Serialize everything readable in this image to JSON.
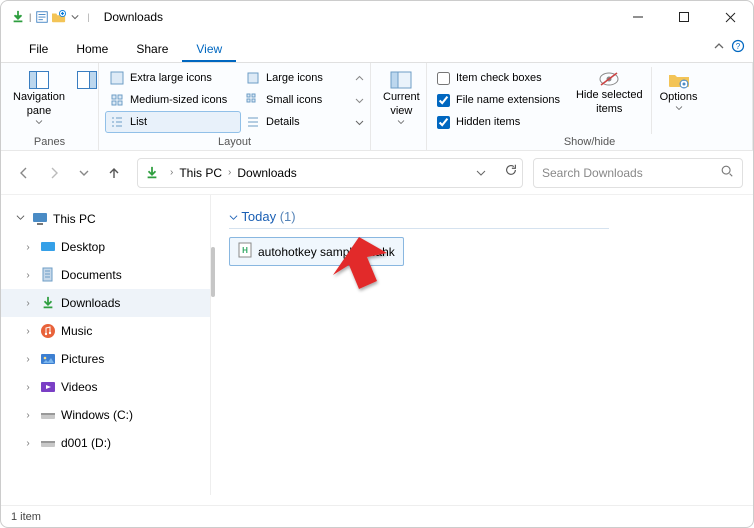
{
  "window": {
    "title": "Downloads"
  },
  "menus": {
    "file": "File",
    "home": "Home",
    "share": "Share",
    "view": "View"
  },
  "ribbon": {
    "panes_group": "Panes",
    "nav_pane": "Navigation\npane",
    "layout_group": "Layout",
    "layout": {
      "xl": "Extra large icons",
      "large": "Large icons",
      "med": "Medium-sized icons",
      "small": "Small icons",
      "list": "List",
      "details": "Details"
    },
    "current_view_group": "Current\nview",
    "showhide_group": "Show/hide",
    "check_boxes": "Item check boxes",
    "file_ext": "File name extensions",
    "hidden_items": "Hidden items",
    "hide_selected": "Hide selected\nitems",
    "options": "Options"
  },
  "address": {
    "root": "This PC",
    "current": "Downloads",
    "search_placeholder": "Search Downloads"
  },
  "tree": {
    "root": "This PC",
    "items": [
      {
        "label": "Desktop"
      },
      {
        "label": "Documents"
      },
      {
        "label": "Downloads",
        "selected": true
      },
      {
        "label": "Music"
      },
      {
        "label": "Pictures"
      },
      {
        "label": "Videos"
      },
      {
        "label": "Windows (C:)"
      },
      {
        "label": "d001 (D:)"
      }
    ]
  },
  "content": {
    "group_label": "Today",
    "group_count": "(1)",
    "file_name": "autohotkey sample01.ahk"
  },
  "status": {
    "text": "1 item"
  }
}
